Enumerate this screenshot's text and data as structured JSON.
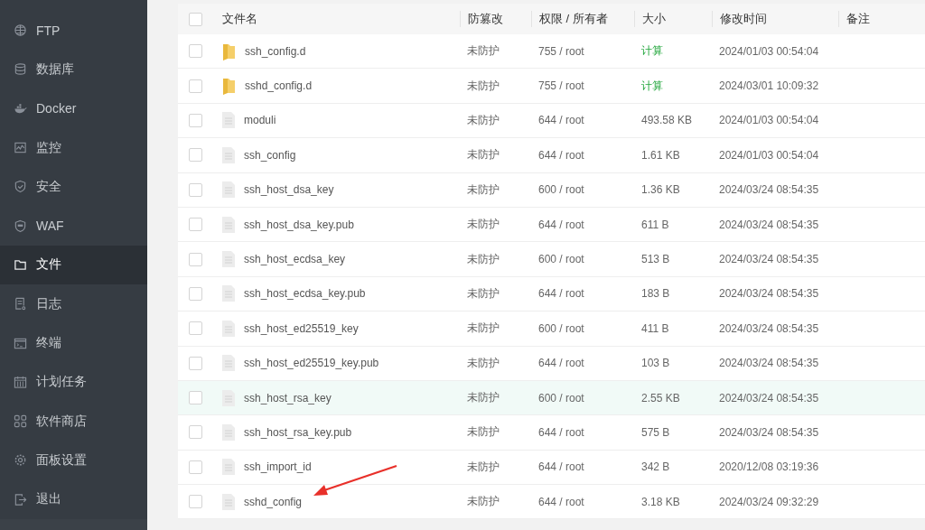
{
  "sidebar": {
    "items": [
      {
        "label": "FTP",
        "selected": false
      },
      {
        "label": "数据库",
        "selected": false
      },
      {
        "label": "Docker",
        "selected": false
      },
      {
        "label": "监控",
        "selected": false
      },
      {
        "label": "安全",
        "selected": false
      },
      {
        "label": "WAF",
        "selected": false
      },
      {
        "label": "文件",
        "selected": true
      },
      {
        "label": "日志",
        "selected": false
      },
      {
        "label": "终端",
        "selected": false
      },
      {
        "label": "计划任务",
        "selected": false
      },
      {
        "label": "软件商店",
        "selected": false
      },
      {
        "label": "面板设置",
        "selected": false
      },
      {
        "label": "退出",
        "selected": false
      }
    ]
  },
  "table": {
    "header_checked": false,
    "columns": [
      "文件名",
      "防篡改",
      "权限 / 所有者",
      "大小",
      "修改时间",
      "备注"
    ],
    "rows": [
      {
        "kind": "folder",
        "name": "ssh_config.d",
        "tamper": "未防护",
        "permission": "755 / root",
        "size": "计算",
        "modified": "2024/01/03 00:54:04",
        "checked": false,
        "highlighted": false
      },
      {
        "kind": "folder",
        "name": "sshd_config.d",
        "tamper": "未防护",
        "permission": "755 / root",
        "size": "计算",
        "modified": "2024/03/01 10:09:32",
        "checked": false,
        "highlighted": false
      },
      {
        "kind": "file",
        "name": "moduli",
        "tamper": "未防护",
        "permission": "644 / root",
        "size": "493.58 KB",
        "modified": "2024/01/03 00:54:04",
        "checked": false,
        "highlighted": false
      },
      {
        "kind": "file",
        "name": "ssh_config",
        "tamper": "未防护",
        "permission": "644 / root",
        "size": "1.61 KB",
        "modified": "2024/01/03 00:54:04",
        "checked": false,
        "highlighted": false
      },
      {
        "kind": "file",
        "name": "ssh_host_dsa_key",
        "tamper": "未防护",
        "permission": "600 / root",
        "size": "1.36 KB",
        "modified": "2024/03/24 08:54:35",
        "checked": false,
        "highlighted": false
      },
      {
        "kind": "file",
        "name": "ssh_host_dsa_key.pub",
        "tamper": "未防护",
        "permission": "644 / root",
        "size": "611 B",
        "modified": "2024/03/24 08:54:35",
        "checked": false,
        "highlighted": false
      },
      {
        "kind": "file",
        "name": "ssh_host_ecdsa_key",
        "tamper": "未防护",
        "permission": "600 / root",
        "size": "513 B",
        "modified": "2024/03/24 08:54:35",
        "checked": false,
        "highlighted": false
      },
      {
        "kind": "file",
        "name": "ssh_host_ecdsa_key.pub",
        "tamper": "未防护",
        "permission": "644 / root",
        "size": "183 B",
        "modified": "2024/03/24 08:54:35",
        "checked": false,
        "highlighted": false
      },
      {
        "kind": "file",
        "name": "ssh_host_ed25519_key",
        "tamper": "未防护",
        "permission": "600 / root",
        "size": "411 B",
        "modified": "2024/03/24 08:54:35",
        "checked": false,
        "highlighted": false
      },
      {
        "kind": "file",
        "name": "ssh_host_ed25519_key.pub",
        "tamper": "未防护",
        "permission": "644 / root",
        "size": "103 B",
        "modified": "2024/03/24 08:54:35",
        "checked": false,
        "highlighted": false
      },
      {
        "kind": "file",
        "name": "ssh_host_rsa_key",
        "tamper": "未防护",
        "permission": "600 / root",
        "size": "2.55 KB",
        "modified": "2024/03/24 08:54:35",
        "checked": false,
        "highlighted": true
      },
      {
        "kind": "file",
        "name": "ssh_host_rsa_key.pub",
        "tamper": "未防护",
        "permission": "644 / root",
        "size": "575 B",
        "modified": "2024/03/24 08:54:35",
        "checked": false,
        "highlighted": false
      },
      {
        "kind": "file",
        "name": "ssh_import_id",
        "tamper": "未防护",
        "permission": "644 / root",
        "size": "342 B",
        "modified": "2020/12/08 03:19:36",
        "checked": false,
        "highlighted": false
      },
      {
        "kind": "file",
        "name": "sshd_config",
        "tamper": "未防护",
        "permission": "644 / root",
        "size": "3.18 KB",
        "modified": "2024/03/24 09:32:29",
        "checked": false,
        "highlighted": false
      }
    ]
  },
  "annotation": {
    "kind": "arrow"
  }
}
